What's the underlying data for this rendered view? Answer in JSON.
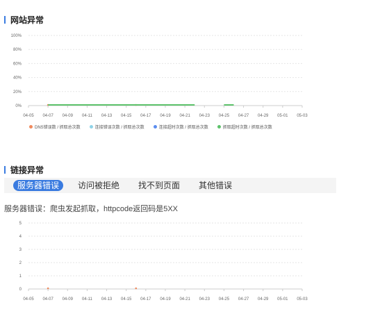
{
  "sections": {
    "site_abnormal": "网站异常",
    "link_abnormal": "链接异常"
  },
  "legend": [
    {
      "label": "DNS错误数 / 抓取总次数",
      "color": "#f08a5d"
    },
    {
      "label": "连接错误次数 / 抓取总次数",
      "color": "#8fd3e8"
    },
    {
      "label": "连接超时次数 / 抓取总次数",
      "color": "#5b8def"
    },
    {
      "label": "抓取超时次数 / 抓取总次数",
      "color": "#5dc26b"
    }
  ],
  "tabs": [
    {
      "label": "服务器错误",
      "active": true
    },
    {
      "label": "访问被拒绝",
      "active": false
    },
    {
      "label": "找不到页面",
      "active": false
    },
    {
      "label": "其他错误",
      "active": false
    }
  ],
  "description": "服务器错误：爬虫发起抓取，httpcode返回码是5XX",
  "chart_data": [
    {
      "type": "line",
      "x": [
        "04-05",
        "04-07",
        "04-09",
        "04-11",
        "04-13",
        "04-15",
        "04-17",
        "04-19",
        "04-21",
        "04-23",
        "04-25",
        "04-27",
        "04-29",
        "05-01",
        "05-03"
      ],
      "yticks": [
        "100%",
        "80%",
        "60%",
        "40%",
        "20%",
        "0%"
      ],
      "ylim": [
        0,
        100
      ],
      "series": [
        {
          "name": "DNS错误数 / 抓取总次数",
          "color": "#f08a5d",
          "points": [
            {
              "x": "04-07",
              "y": 0
            },
            {
              "x": "04-16",
              "y": 0
            }
          ]
        },
        {
          "name": "抓取超时次数 / 抓取总次数",
          "color": "#5dc26b",
          "segments": [
            [
              "04-07",
              "04-22"
            ],
            [
              "04-25",
              "04-26"
            ]
          ],
          "y": 0
        }
      ]
    },
    {
      "type": "line",
      "x": [
        "04-05",
        "04-07",
        "04-09",
        "04-11",
        "04-13",
        "04-15",
        "04-17",
        "04-19",
        "04-21",
        "04-23",
        "04-25",
        "04-27",
        "04-29",
        "05-01",
        "05-03"
      ],
      "yticks": [
        "5",
        "4",
        "3",
        "2",
        "1",
        "0"
      ],
      "ylim": [
        0,
        5
      ],
      "series": [
        {
          "color": "#f08a5d",
          "points": [
            {
              "x": "04-07",
              "y": 0
            },
            {
              "x": "04-16",
              "y": 0
            }
          ]
        }
      ]
    }
  ]
}
